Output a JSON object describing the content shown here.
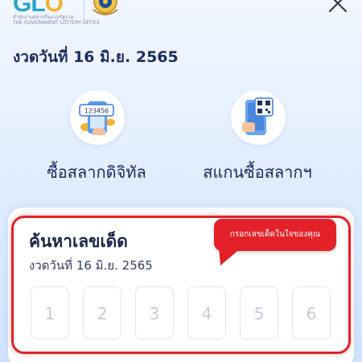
{
  "header": {
    "logo_text": "GLO",
    "logo_subtitle_th": "สำนักงานสลากกินแบ่งรัฐบาล",
    "logo_subtitle_en": "THE GOVERNMENT LOTTERY OFFICE"
  },
  "draw": {
    "label": "งวดวันที่ 16 มิ.ย. 2565"
  },
  "services": [
    {
      "label": "ซื้อสลากดิจิทัล",
      "icon": "phone-ticket-coins-icon",
      "ticket_number": "123456"
    },
    {
      "label": "สแกนซื้อสลากฯ",
      "icon": "phone-qr-scan-icon"
    }
  ],
  "search": {
    "title": "ค้นหาเลขเด็ด",
    "date_label": "งวดวันที่  16 มิ.ย. 2565",
    "tooltip": "กรอกเลขเด็ดในใจของคุณ",
    "digit_placeholders": [
      "1",
      "2",
      "3",
      "4",
      "5",
      "6"
    ]
  },
  "colors": {
    "accent_red": "#e42128",
    "title_navy": "#1e2c5e",
    "logo_teal": "#2aa6c9"
  }
}
